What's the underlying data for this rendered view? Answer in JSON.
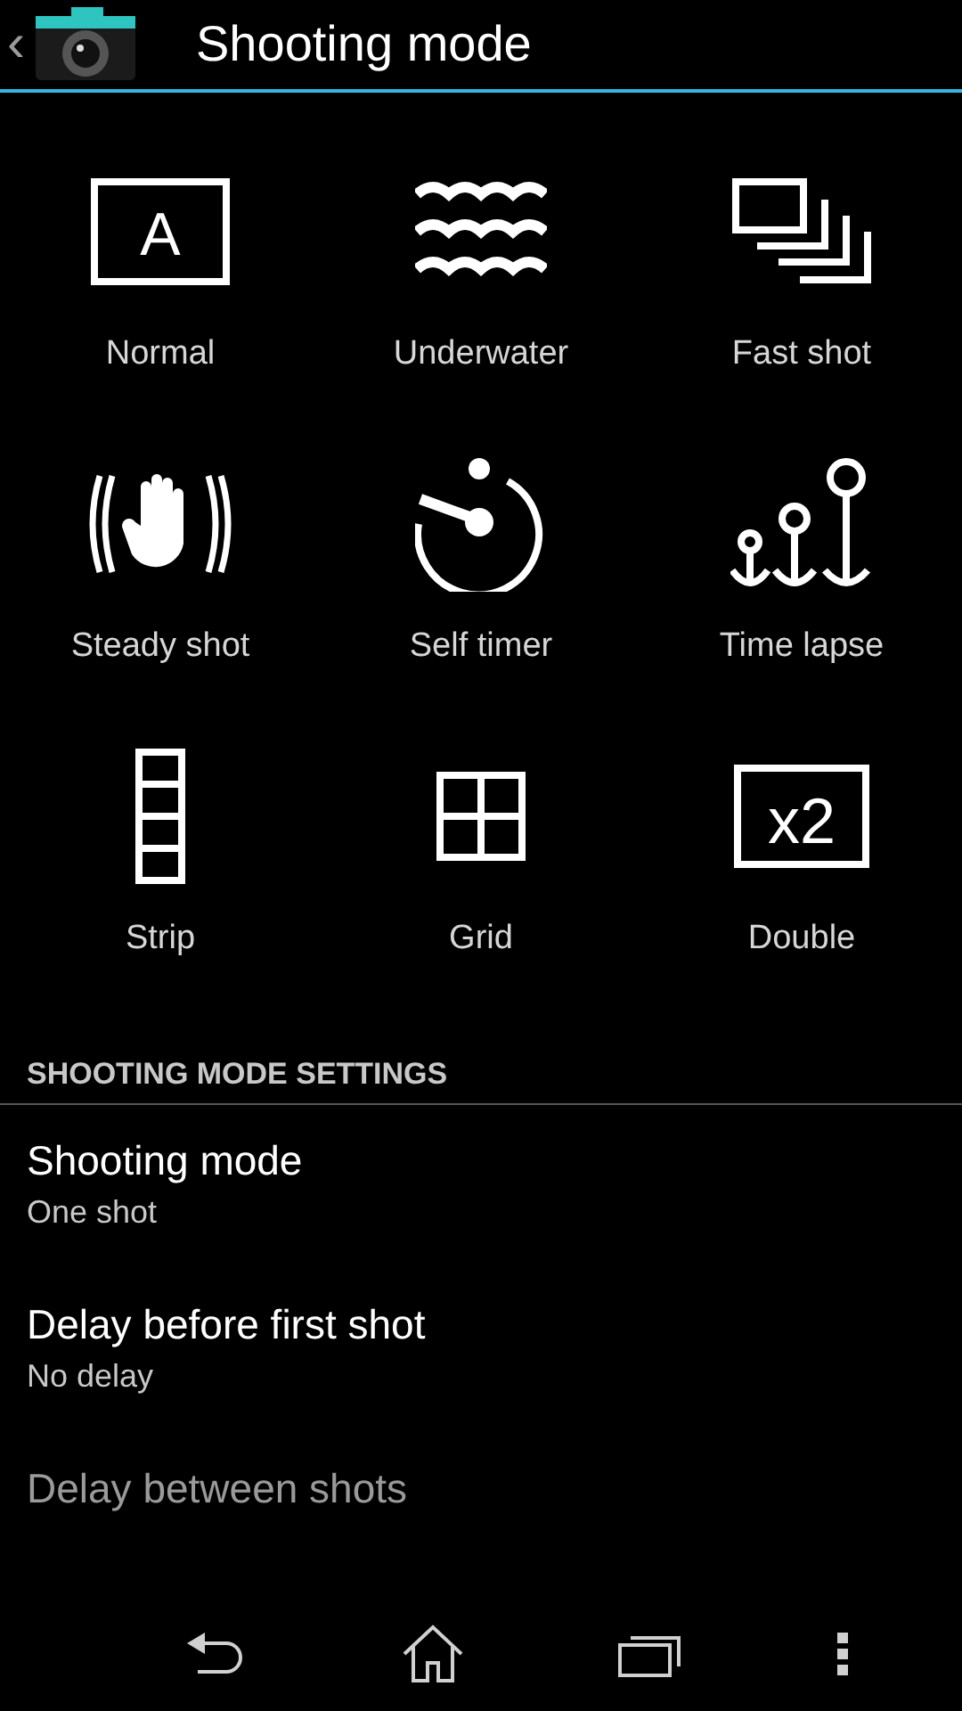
{
  "action_bar": {
    "back_glyph": "‹",
    "title": "Shooting mode"
  },
  "modes": [
    {
      "kind": "normal",
      "label": "Normal",
      "icon_text": "A"
    },
    {
      "kind": "underwater",
      "label": "Underwater"
    },
    {
      "kind": "fast",
      "label": "Fast shot"
    },
    {
      "kind": "steady",
      "label": "Steady shot"
    },
    {
      "kind": "timer",
      "label": "Self timer"
    },
    {
      "kind": "lapse",
      "label": "Time lapse"
    },
    {
      "kind": "strip",
      "label": "Strip"
    },
    {
      "kind": "grid",
      "label": "Grid"
    },
    {
      "kind": "double",
      "label": "Double",
      "icon_text": "x2"
    }
  ],
  "settings": {
    "header": "SHOOTING MODE SETTINGS",
    "items": [
      {
        "title": "Shooting mode",
        "summary": "One shot"
      },
      {
        "title": "Delay before first shot",
        "summary": "No delay"
      },
      {
        "title": "Delay between shots"
      }
    ]
  },
  "nav_bar": [
    {
      "kind": "back"
    },
    {
      "kind": "home"
    },
    {
      "kind": "recents"
    },
    {
      "kind": "menu"
    }
  ]
}
